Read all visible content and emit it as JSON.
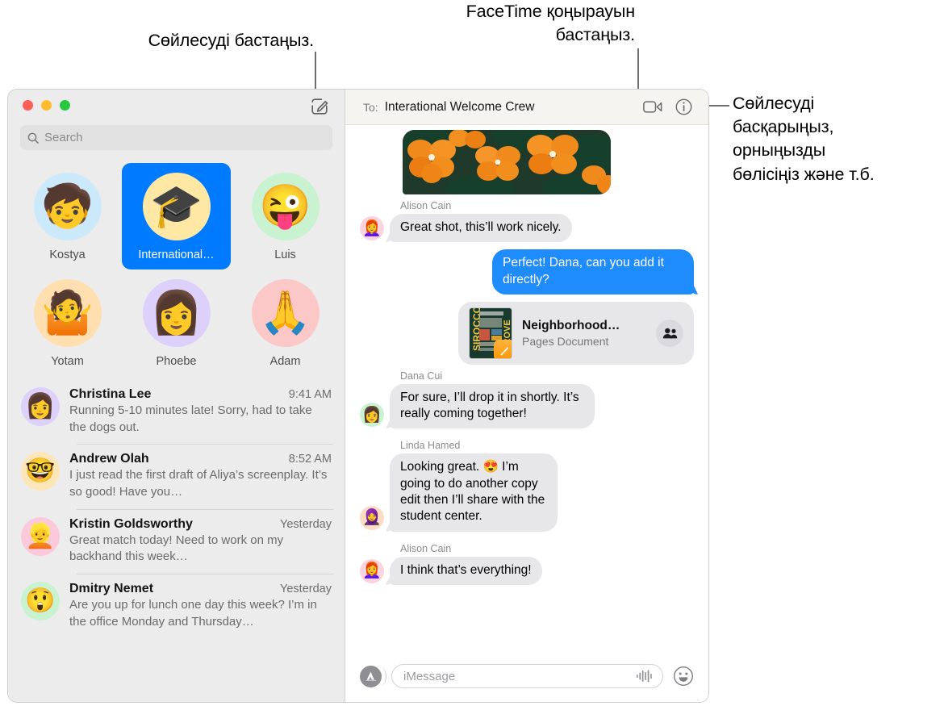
{
  "callouts": {
    "left": "Сөйлесуді бастаңыз.",
    "top": "FaceTime қоңырауын\nбастаңыз.",
    "right": "Сөйлесуді\nбасқарыңыз,\nорныңызды\nбөлісіңіз және т.б."
  },
  "window": {
    "traffic_lights": [
      "close",
      "minimize",
      "maximize"
    ],
    "compose_icon": "compose-icon"
  },
  "sidebar": {
    "search": {
      "placeholder": "Search",
      "icon": "search-icon"
    },
    "pinned": [
      {
        "name": "Kostya",
        "glyph": "🧒",
        "bg": "#cbe9fb",
        "selected": false
      },
      {
        "name": "International…",
        "glyph": "🎓",
        "bg": "#ffe8a3",
        "selected": true
      },
      {
        "name": "Luis",
        "glyph": "😜",
        "bg": "#c9f2d0",
        "selected": false
      },
      {
        "name": "Yotam",
        "glyph": "🤷",
        "bg": "#ffdfb0",
        "selected": false
      },
      {
        "name": "Phoebe",
        "glyph": "👩",
        "bg": "#ddd0fb",
        "selected": false
      },
      {
        "name": "Adam",
        "glyph": "🙏",
        "bg": "#fcc7c7",
        "selected": false
      }
    ],
    "conversations": [
      {
        "name": "Christina Lee",
        "time": "9:41 AM",
        "preview": "Running 5-10 minutes late! Sorry, had to take the dogs out.",
        "glyph": "👩",
        "bg": "#ddd0fb"
      },
      {
        "name": "Andrew Olah",
        "time": "8:52 AM",
        "preview": "I just read the first draft of Aliya’s screenplay. It’s so good! Have you…",
        "glyph": "🤓",
        "bg": "#fde6b8"
      },
      {
        "name": "Kristin Goldsworthy",
        "time": "Yesterday",
        "preview": "Great match today! Need to work on my backhand this week…",
        "glyph": "👱",
        "bg": "#fbc8dc"
      },
      {
        "name": "Dmitry Nemet",
        "time": "Yesterday",
        "preview": "Are you up for lunch one day this week? I’m in the office Monday and Thursday…",
        "glyph": "😲",
        "bg": "#c9f2d0"
      }
    ]
  },
  "thread": {
    "to_label": "To:",
    "to_value": "Interational Welcome Crew",
    "facetime_icon": "video-camera-icon",
    "info_icon": "info-circle-icon",
    "photo_attachment": {
      "alt": "orange flowers photo"
    },
    "messages": [
      {
        "kind": "text",
        "direction": "in",
        "sender": "Alison Cain",
        "text": "Great shot, this’ll work nicely.",
        "glyph": "👩‍🦰",
        "bg": "#fbd4e0"
      },
      {
        "kind": "text",
        "direction": "out",
        "sender": "",
        "text": "Perfect! Dana, can you add it directly?",
        "glyph": "",
        "bg": ""
      },
      {
        "kind": "document",
        "direction": "out",
        "title": "Neighborhood…",
        "subtitle": "Pages Document",
        "share_icon": "people-icon",
        "badge_icon": "pages-app-icon"
      },
      {
        "kind": "text",
        "direction": "in",
        "sender": "Dana Cui",
        "text": "For sure, I’ll drop it in shortly. It’s really coming together!",
        "glyph": "👩",
        "bg": "#c9f2d0"
      },
      {
        "kind": "text",
        "direction": "in",
        "sender": "Linda Hamed",
        "text": "Looking great. 😍 I’m going to do another copy edit then I’ll share with the student center.",
        "glyph": "🧕",
        "bg": "#fddcc4"
      },
      {
        "kind": "text",
        "direction": "in",
        "sender": "Alison Cain",
        "text": "I think that’s everything!",
        "glyph": "👩‍🦰",
        "bg": "#fbd4e0"
      }
    ],
    "composer": {
      "apps_icon": "app-store-icon",
      "placeholder": "iMessage",
      "audio_icon": "audio-waveform-icon",
      "emoji_icon": "smiley-icon"
    }
  },
  "colors": {
    "accent_blue": "#007aff",
    "bubble_out": "#1e8cfc",
    "bubble_in": "#e7e7e9",
    "sidebar_bg": "#ececec"
  }
}
